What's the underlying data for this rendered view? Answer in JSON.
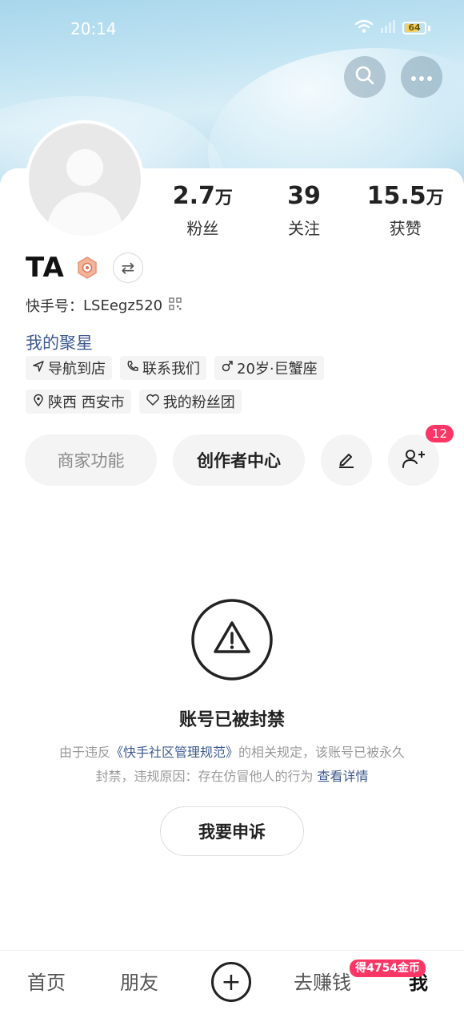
{
  "status": {
    "time": "20:14",
    "battery": "64"
  },
  "stats": [
    {
      "num": "2.7",
      "unit": "万",
      "label": "粉丝"
    },
    {
      "num": "39",
      "unit": "",
      "label": "关注"
    },
    {
      "num": "15.5",
      "unit": "万",
      "label": "获赞"
    }
  ],
  "profile": {
    "name": "TA",
    "switch_icon": "⇄",
    "account_label": "快手号：",
    "account_id": "LSEegz520",
    "star_link": "我的聚星",
    "tags_row1": [
      "导航到店",
      "联系我们",
      "20岁·巨蟹座"
    ],
    "tags_row2": [
      "陕西 西安市",
      "我的粉丝团"
    ]
  },
  "actions": {
    "merchant": "商家功能",
    "creator": "创作者中心",
    "friend_badge": "12"
  },
  "ban": {
    "title": "账号已被封禁",
    "desc_part1": "由于违反",
    "desc_link1": "《快手社区管理规范》",
    "desc_part2": "的相关规定，该账号已被永久封禁，违规原因：存在仿冒他人的行为",
    "desc_link2": "查看详情",
    "appeal": "我要申诉"
  },
  "nav": {
    "home": "首页",
    "friends": "朋友",
    "plus": "+",
    "earn": "去赚钱",
    "me": "我",
    "coin_badge": "得4754金币"
  },
  "colors": {
    "accent_link": "#3e5a92",
    "badge_red": "#fe3666"
  }
}
